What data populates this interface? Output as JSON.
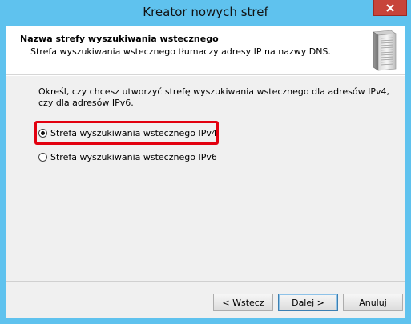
{
  "window": {
    "title": "Kreator nowych stref"
  },
  "header": {
    "title": "Nazwa strefy wyszukiwania wstecznego",
    "subtitle": "Strefa wyszukiwania wstecznego tłumaczy adresy IP na nazwy DNS."
  },
  "body": {
    "description": "Określ, czy chcesz utworzyć strefę wyszukiwania wstecznego dla adresów IPv4, czy dla adresów IPv6.",
    "options": [
      {
        "label": "Strefa wyszukiwania wstecznego IPv4",
        "selected": true
      },
      {
        "label": "Strefa wyszukiwania wstecznego IPv6",
        "selected": false
      }
    ]
  },
  "buttons": {
    "back": "< Wstecz",
    "next": "Dalej >",
    "cancel": "Anuluj"
  },
  "colors": {
    "title_bar": "#5fc2ee",
    "close_button": "#c7443a",
    "highlight": "#e2000f"
  }
}
